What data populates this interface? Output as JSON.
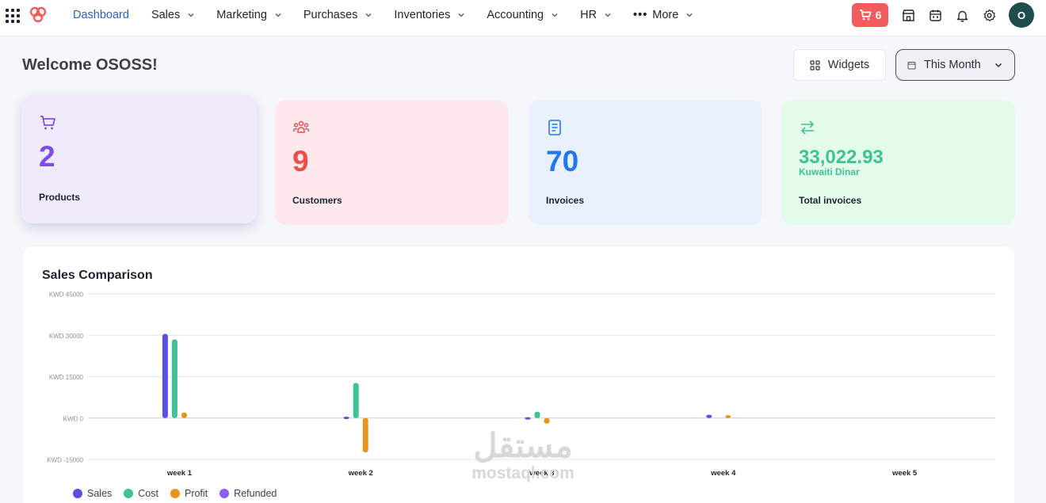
{
  "nav": {
    "items": [
      {
        "label": "Dashboard",
        "active": true,
        "has_menu": false
      },
      {
        "label": "Sales",
        "has_menu": true
      },
      {
        "label": "Marketing",
        "has_menu": true
      },
      {
        "label": "Purchases",
        "has_menu": true
      },
      {
        "label": "Inventories",
        "has_menu": true
      },
      {
        "label": "Accounting",
        "has_menu": true
      },
      {
        "label": "HR",
        "has_menu": true
      },
      {
        "label": "More",
        "has_menu": true,
        "has_dots": true
      }
    ],
    "cart_count": "6",
    "avatar_initial": "O",
    "icons": [
      "apps-grid-icon",
      "logo-icon",
      "cart-icon",
      "store-icon",
      "calendar-icon",
      "bell-icon",
      "gear-icon"
    ]
  },
  "header": {
    "welcome": "Welcome OSOSS!",
    "widgets_label": "Widgets",
    "period_label": "This Month"
  },
  "cards": [
    {
      "value": "2",
      "label": "Products",
      "icon": "cart-icon",
      "color": "#7c4ded"
    },
    {
      "value": "9",
      "label": "Customers",
      "icon": "users-icon",
      "color": "#ee4b4b"
    },
    {
      "value": "70",
      "label": "Invoices",
      "icon": "receipt-icon",
      "color": "#2577ea"
    },
    {
      "value": "33,022.93",
      "sub": "Kuwaiti Dinar",
      "label": "Total invoices",
      "icon": "transfer-icon",
      "color": "#3ec296"
    }
  ],
  "chart_panel": {
    "title": "Sales Comparison"
  },
  "chart_data": {
    "type": "bar",
    "title": "Sales Comparison",
    "categories": [
      "week 1",
      "week 2",
      "week 3",
      "week 4",
      "week 5"
    ],
    "ylim": [
      -15000,
      45000
    ],
    "yticks": [
      -15000,
      0,
      15000,
      30000,
      45000
    ],
    "ytick_labels": [
      "KWD -15000",
      "KWD 0",
      "KWD 15000",
      "KWD 30000",
      "KWD 45000"
    ],
    "grid": true,
    "legend": "bottom-left",
    "series": [
      {
        "name": "Sales",
        "color": "#5b4fe6",
        "values": [
          30500,
          500,
          300,
          1200,
          0
        ]
      },
      {
        "name": "Cost",
        "color": "#3ec296",
        "values": [
          28500,
          12700,
          2300,
          0,
          0
        ]
      },
      {
        "name": "Profit",
        "color": "#e8951e",
        "values": [
          2000,
          -12400,
          -2000,
          1000,
          0
        ]
      },
      {
        "name": "Refunded",
        "color": "#8b5cf6",
        "values": [
          0,
          0,
          0,
          0,
          0
        ]
      }
    ]
  },
  "watermark": {
    "arabic": "مستقل",
    "latin": "mostaql.com"
  }
}
